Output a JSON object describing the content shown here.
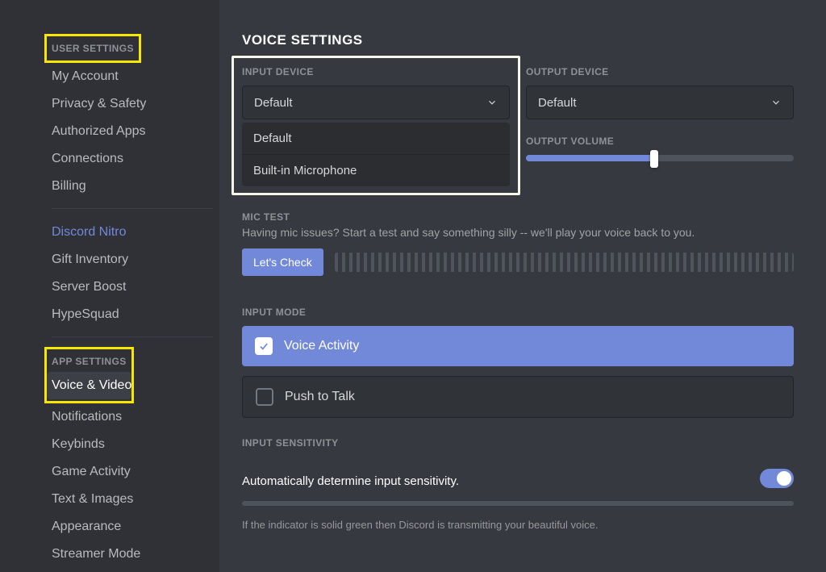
{
  "sidebar": {
    "user_header": "USER SETTINGS",
    "user_items": [
      "My Account",
      "Privacy & Safety",
      "Authorized Apps",
      "Connections",
      "Billing"
    ],
    "nitro_items": [
      "Discord Nitro",
      "Gift Inventory",
      "Server Boost",
      "HypeSquad"
    ],
    "app_header": "APP SETTINGS",
    "app_items": [
      "Voice & Video",
      "Notifications",
      "Keybinds",
      "Game Activity",
      "Text & Images",
      "Appearance",
      "Streamer Mode"
    ],
    "active_item": "Voice & Video",
    "nitro_highlight": "Discord Nitro"
  },
  "main": {
    "title": "VOICE SETTINGS",
    "input_device": {
      "label": "INPUT DEVICE",
      "selected": "Default",
      "options": [
        "Default",
        "Built-in Microphone"
      ]
    },
    "output_device": {
      "label": "OUTPUT DEVICE",
      "selected": "Default"
    },
    "output_volume": {
      "label": "OUTPUT VOLUME",
      "value_percent": 48
    },
    "mic_test": {
      "label": "MIC TEST",
      "help": "Having mic issues? Start a test and say something silly -- we'll play your voice back to you.",
      "button": "Let's Check"
    },
    "input_mode": {
      "label": "INPUT MODE",
      "voice_activity": "Voice Activity",
      "push_to_talk": "Push to Talk",
      "selected": "voice_activity"
    },
    "sensitivity": {
      "label": "INPUT SENSITIVITY",
      "auto_label": "Automatically determine input sensitivity.",
      "auto_on": true,
      "help": "If the indicator is solid green then Discord is transmitting your beautiful voice."
    }
  }
}
